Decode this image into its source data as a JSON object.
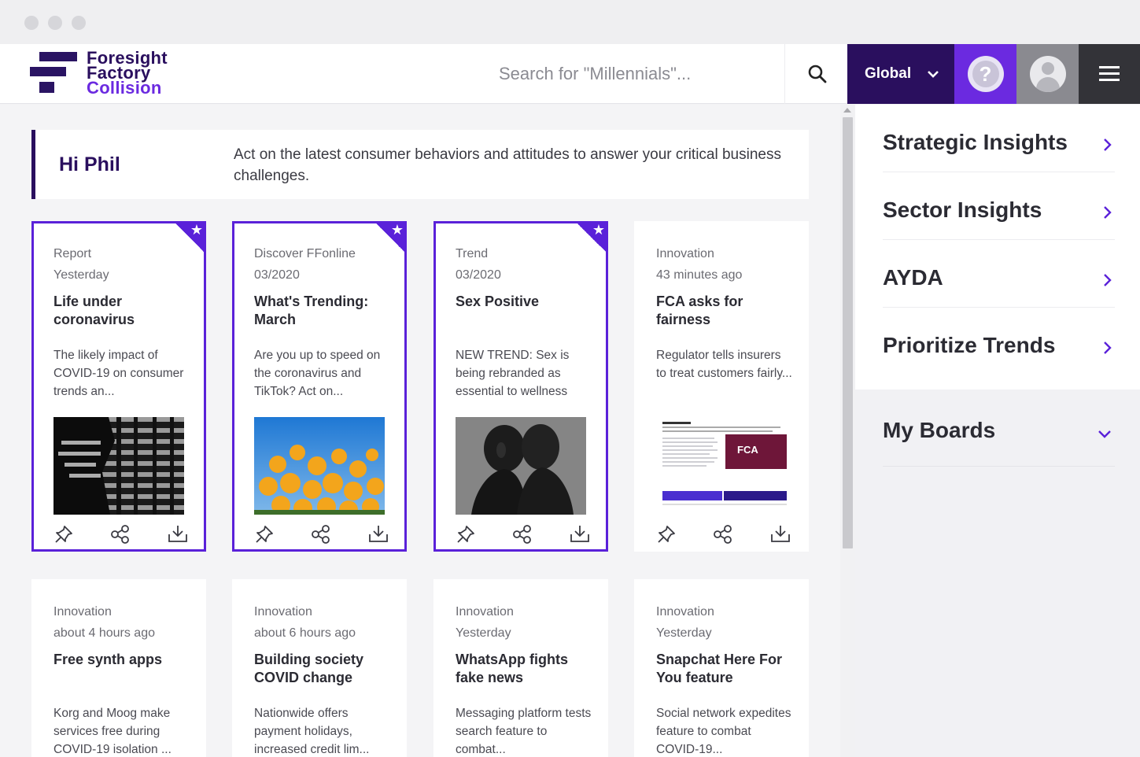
{
  "header": {
    "logo_line1": "Foresight",
    "logo_line2": "Factory",
    "logo_line3": "Collision",
    "search_placeholder": "Search for \"Millennials\"...",
    "region_label": "Global",
    "brand_color": "#2a0f5e",
    "accent_color": "#5a21d9"
  },
  "welcome": {
    "name": "Hi Phil",
    "message": "Act on the latest consumer behaviors and attitudes to answer your critical business challenges."
  },
  "cards_row1": [
    {
      "type": "Report",
      "date": "Yesterday",
      "title": "Life under coronavirus",
      "desc": "The likely impact of COVID-19 on consumer trends an...",
      "featured": true,
      "image": "photo-blinds-silhouette"
    },
    {
      "type": "Discover FFonline",
      "date": "03/2020",
      "title": "What's Trending: March",
      "desc": "Are you up to speed on the coronavirus and TikTok? Act on...",
      "featured": true,
      "image": "photo-yellow-flowers-sky"
    },
    {
      "type": "Trend",
      "date": "03/2020",
      "title": "Sex Positive",
      "desc": "NEW TREND: Sex is being rebranded as essential to wellness",
      "featured": true,
      "image": "photo-couple-bw"
    },
    {
      "type": "Innovation",
      "date": "43 minutes ago",
      "title": "FCA asks for fairness",
      "desc": "Regulator tells insurers to treat customers fairly...",
      "featured": false,
      "image": "document-page-fca",
      "fca_badge": "FCA"
    }
  ],
  "cards_row2": [
    {
      "type": "Innovation",
      "date": "about 4 hours ago",
      "title": "Free synth apps",
      "desc": "Korg and Moog make services free during COVID-19 isolation ..."
    },
    {
      "type": "Innovation",
      "date": "about 6 hours ago",
      "title": "Building society COVID change",
      "desc": "Nationwide offers payment holidays, increased credit lim..."
    },
    {
      "type": "Innovation",
      "date": "Yesterday",
      "title": "WhatsApp fights fake news",
      "desc": "Messaging platform tests search feature to combat..."
    },
    {
      "type": "Innovation",
      "date": "Yesterday",
      "title": "Snapchat Here For You feature",
      "desc": "Social network expedites feature to combat COVID-19..."
    }
  ],
  "card_actions": [
    "pin-icon",
    "share-icon",
    "download-icon"
  ],
  "sidebar": {
    "items": [
      {
        "label": "Strategic Insights"
      },
      {
        "label": "Sector Insights"
      },
      {
        "label": "AYDA"
      },
      {
        "label": "Prioritize Trends"
      }
    ],
    "boards_label": "My Boards"
  }
}
